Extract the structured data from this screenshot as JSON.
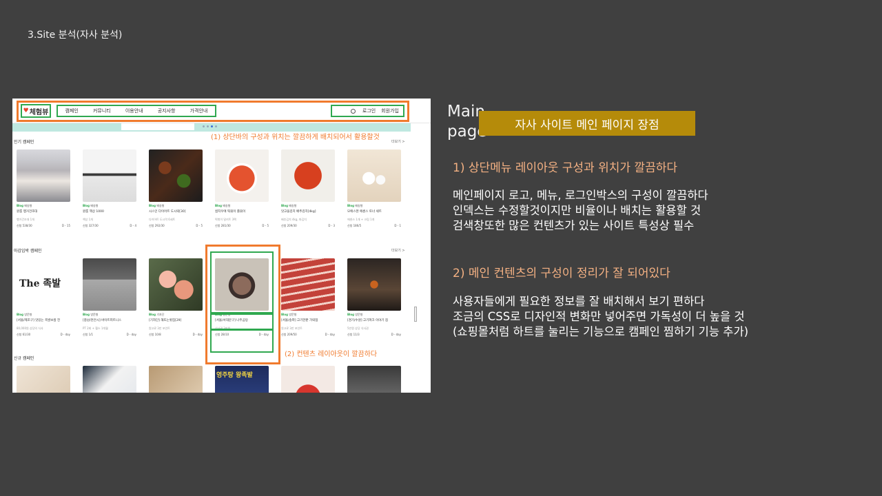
{
  "slide": {
    "title": "3.Site 분석(자사 분석)"
  },
  "screenshot": {
    "logo": "체험뷰",
    "menu": [
      "캠페인",
      "커뮤니티",
      "이용안내",
      "공지사항",
      "가격안내"
    ],
    "login": "로그인",
    "signup": "회원가입",
    "annotation_top": "(1) 상단바의 구성과 위치는 깔끔하게 배치되어서 활용할것",
    "annotation_content": "(2) 컨텐츠 레이아웃이 깔끔하다",
    "more_label": "더보기 >",
    "sections": [
      {
        "title": "인기 캠페인",
        "cards": [
          {
            "tag": "배송형",
            "title": "원룸 행거건조대",
            "desc": "행거건조대 1개",
            "count": "신청 538/30",
            "dday": "D - 15",
            "img": "hanger"
          },
          {
            "tag": "배송형",
            "title": "원룸 책상 1000",
            "desc": "책상 1개",
            "count": "신청 327/30",
            "dday": "D - 4",
            "img": "desk"
          },
          {
            "tag": "배송형",
            "title": "시스인 다이어트 도시락[30]",
            "desc": "다이어트 도시락 6세트",
            "count": "신청 292/30",
            "dday": "D - 5",
            "img": "lunchbox"
          },
          {
            "tag": "배송형",
            "title": "쌈지우에 떡볶이 쫄볶이",
            "desc": "떡볶이 밀키트 3팩",
            "count": "신청 281/30",
            "dday": "D - 5",
            "img": "tteok"
          },
          {
            "tag": "배송형",
            "title": "맛고을김치 배추김치[4kg]",
            "desc": "배추김치 4kg, 파김치",
            "count": "신청 209/30",
            "dday": "D - 3",
            "img": "kimchi"
          },
          {
            "tag": "배송형",
            "title": "모에스텐 에센스 토너 세트",
            "desc": "에센스 1개 + 크림 1개",
            "count": "신청 186/5",
            "dday": "D - 1",
            "img": "cosmetic"
          }
        ]
      },
      {
        "title": "마감임박 캠페인",
        "cards": [
          {
            "tag": "방문형",
            "title": "[서울/제조구] 맛있는 족발보쌈 전",
            "desc": "80,000원 상당의 식사",
            "count": "신청 61/30",
            "dday": "D - day",
            "img": "logo-jokbal",
            "logo_text": "The 족발"
          },
          {
            "tag": "방문형",
            "title": "[충남/천안시] 바이트피트니스",
            "desc": "PT 2회 + 헬스 1개월",
            "count": "신청 1/1",
            "dday": "D - day",
            "img": "gym"
          },
          {
            "tag": "기자단",
            "title": "[기자단] 해뜨는횟집[29]",
            "desc": "원고료 3만 포인트",
            "count": "신청 10/8",
            "dday": "D - day",
            "img": "sashimi"
          },
          {
            "tag": "방문형",
            "title": "[서울/서대문구] 나주곰탕",
            "desc": "식사권 3만원",
            "count": "신청 28/10",
            "dday": "D - day",
            "img": "gomtang"
          },
          {
            "tag": "방문형",
            "title": "[서울/송파] 고기한판 가락점",
            "desc": "원고료 3만 포인트",
            "count": "신청 209/50",
            "dday": "D - day",
            "img": "meat"
          },
          {
            "tag": "방문형",
            "title": "[경기/수원] 고기파크 이야기 점",
            "desc": "5만원 상당 식사권",
            "count": "신청 11/3",
            "dday": "D - day",
            "img": "grill"
          }
        ]
      },
      {
        "title": "신규 캠페인",
        "cards": [
          {
            "img": "new1"
          },
          {
            "img": "new2"
          },
          {
            "img": "new3"
          },
          {
            "img": "sign",
            "sign_text": "영주탕 왕족발"
          },
          {
            "img": "new5"
          },
          {
            "img": "new6"
          }
        ]
      }
    ]
  },
  "panel": {
    "main_label": "Main page",
    "pill": "자사 사이트 메인 페이지 장점",
    "heading1": "1) 상단메뉴 레이아웃 구성과 위치가 깔끔하다",
    "para1": [
      "메인페이지 로고, 메뉴, 로그인박스의 구성이 깔끔하다",
      "인덱스는 수정할것이지만 비율이나 배치는 활용할 것",
      "검색창또한 많은 컨텐츠가 있는 사이트 특성상 필수"
    ],
    "heading2": "2) 메인 컨텐츠의 구성이 정리가 잘 되어있다",
    "para2": [
      "사용자들에게 필요한 정보를 잘 배치해서 보기 편하다",
      "조금의 CSS로 디자인적 변화만 넣어주면 가독성이 더 높을 것",
      "(쇼핑몰처럼 하트를 눌리는 기능으로 캠페인 찜하기 기능 추가)"
    ]
  },
  "colors": {
    "background": "#404040",
    "accent_orange": "#f07a2d",
    "accent_green": "#2fa84f",
    "pill_gold": "#b58b0a",
    "heading_peach": "#f4b183"
  }
}
